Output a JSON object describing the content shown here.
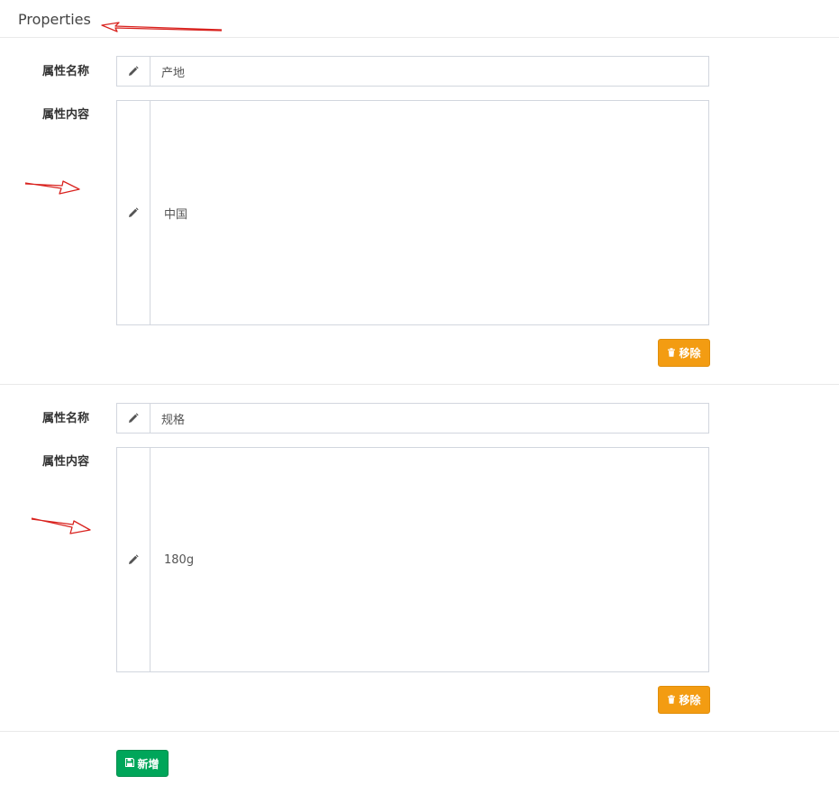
{
  "header": {
    "title": "Properties"
  },
  "properties": [
    {
      "name_label": "属性名称",
      "name_value": "产地",
      "content_label": "属性内容",
      "content_value": "中国",
      "remove_label": "移除"
    },
    {
      "name_label": "属性名称",
      "name_value": "规格",
      "content_label": "属性内容",
      "content_value": "180g",
      "remove_label": "移除"
    }
  ],
  "actions": {
    "add_label": "新增"
  },
  "colors": {
    "warning": "#f39c12",
    "success": "#00a65a",
    "annotation": "#d9231f"
  },
  "icons": {
    "field_addon": "pencil-icon",
    "remove": "trash-icon",
    "add": "save-icon"
  }
}
